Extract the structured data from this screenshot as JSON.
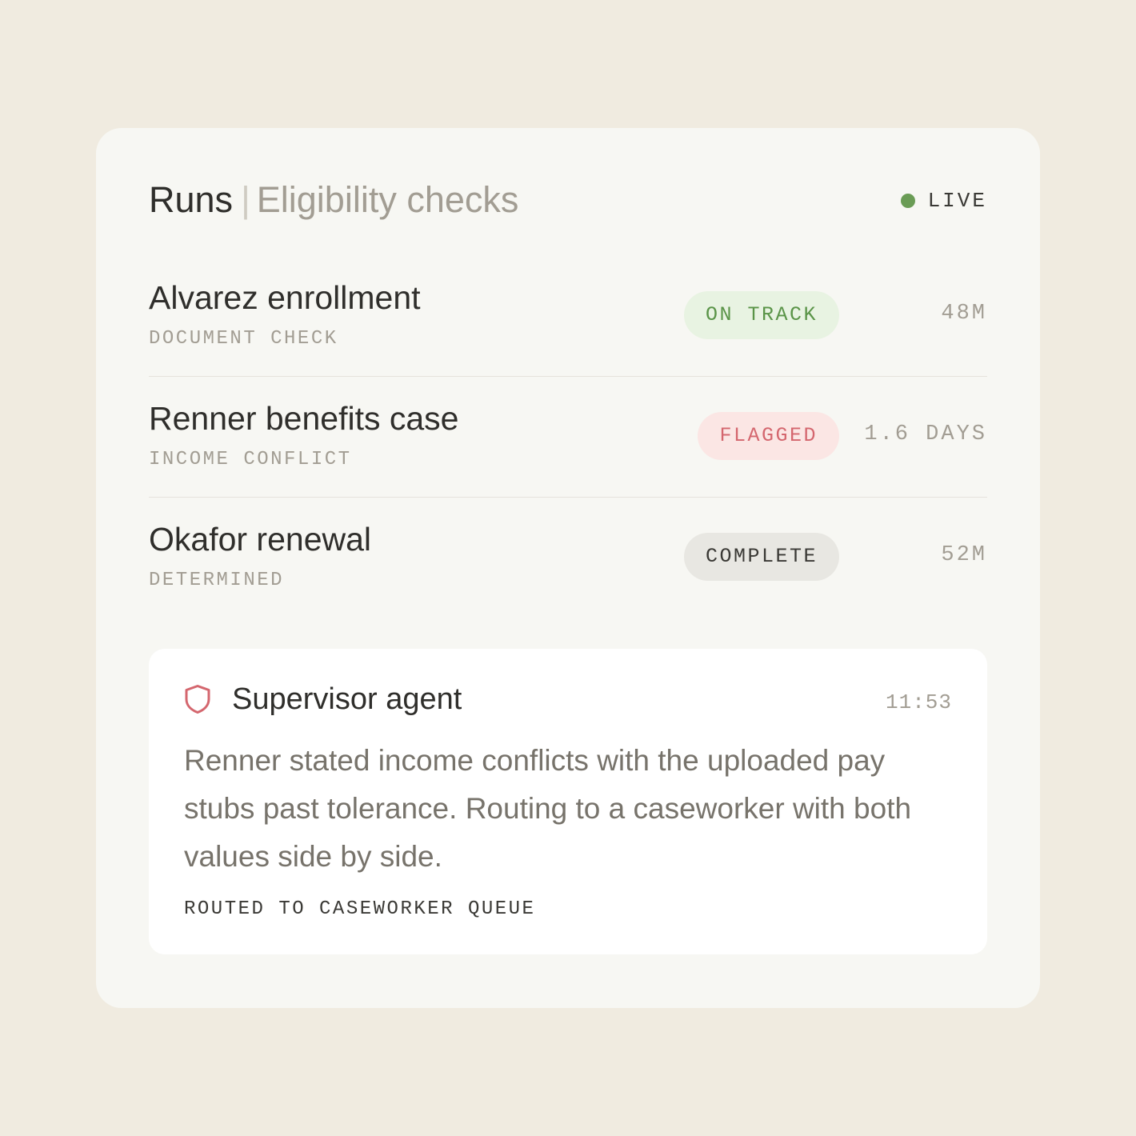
{
  "header": {
    "title": "Runs",
    "separator": "|",
    "subtitle": "Eligibility checks",
    "status": "LIVE",
    "status_color": "#6a9c55"
  },
  "runs": [
    {
      "name": "Alvarez enrollment",
      "subtitle": "DOCUMENT CHECK",
      "status": "ON TRACK",
      "status_kind": "on-track",
      "elapsed": "48M"
    },
    {
      "name": "Renner benefits case",
      "subtitle": "INCOME CONFLICT",
      "status": "FLAGGED",
      "status_kind": "flagged",
      "elapsed": "1.6 DAYS"
    },
    {
      "name": "Okafor renewal",
      "subtitle": "DETERMINED",
      "status": "COMPLETE",
      "status_kind": "complete",
      "elapsed": "52M"
    }
  ],
  "agent": {
    "icon": "shield-icon",
    "name": "Supervisor agent",
    "time": "11:53",
    "message": "Renner stated income conflicts with the uploaded pay stubs past tolerance. Routing to a caseworker with both values side by side.",
    "footer": "ROUTED TO CASEWORKER QUEUE"
  },
  "colors": {
    "background": "#f0ebe0",
    "card": "#f7f7f3",
    "on_track": "#5a9448",
    "flagged": "#d4666e",
    "shield": "#d4666e"
  }
}
